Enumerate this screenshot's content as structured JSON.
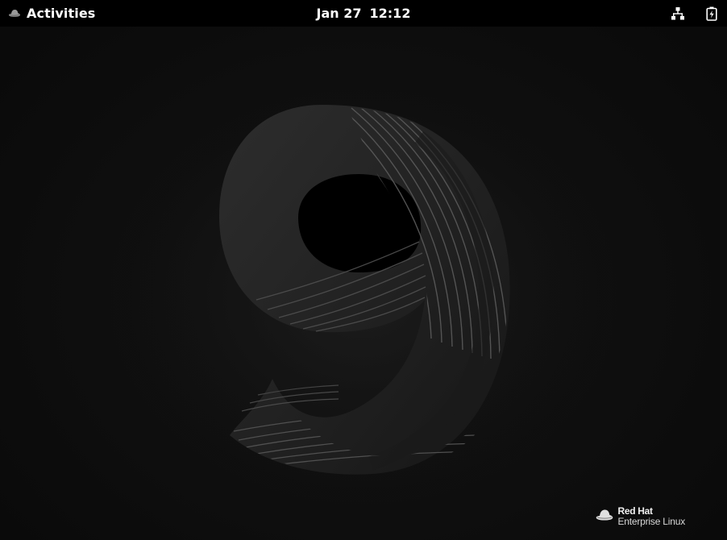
{
  "topbar": {
    "activities_label": "Activities",
    "activities_icon": "redhat-hat-icon",
    "date": "Jan 27",
    "time": "12:12",
    "status_icons": [
      "network-wired-icon",
      "battery-charging-icon"
    ]
  },
  "wallpaper": {
    "numeral": "9",
    "brand_line1": "Red Hat",
    "brand_line2": "Enterprise Linux",
    "brand_icon": "redhat-hat-icon"
  },
  "colors": {
    "topbar_bg": "#000000",
    "desktop_bg": "#0b0b0b",
    "numeral_fill": "#262626",
    "stripe": "#595959",
    "text": "#ffffff"
  }
}
